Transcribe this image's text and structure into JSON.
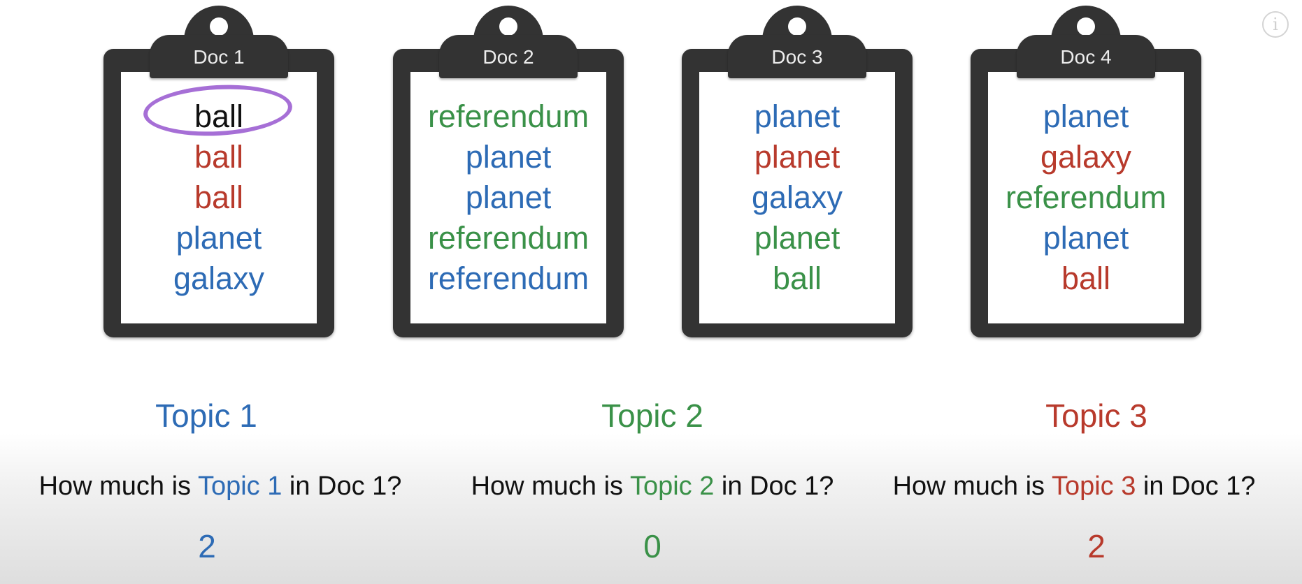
{
  "colors": {
    "topic1": "#2d6bb5",
    "topic2": "#3a9148",
    "topic3": "#b83a2c",
    "neutral": "#111111",
    "highlight": "#a66fd6"
  },
  "info_icon": "i",
  "documents": [
    {
      "label": "Doc 1",
      "words": [
        {
          "text": "ball",
          "topic": "neutral",
          "circled": true
        },
        {
          "text": "ball",
          "topic": "topic3"
        },
        {
          "text": "ball",
          "topic": "topic3"
        },
        {
          "text": "planet",
          "topic": "topic1"
        },
        {
          "text": "galaxy",
          "topic": "topic1"
        }
      ]
    },
    {
      "label": "Doc 2",
      "words": [
        {
          "text": "referendum",
          "topic": "topic2"
        },
        {
          "text": "planet",
          "topic": "topic1"
        },
        {
          "text": "planet",
          "topic": "topic1"
        },
        {
          "text": "referendum",
          "topic": "topic2"
        },
        {
          "text": "referendum",
          "topic": "topic1"
        }
      ]
    },
    {
      "label": "Doc 3",
      "words": [
        {
          "text": "planet",
          "topic": "topic1"
        },
        {
          "text": "planet",
          "topic": "topic3"
        },
        {
          "text": "galaxy",
          "topic": "topic1"
        },
        {
          "text": "planet",
          "topic": "topic2"
        },
        {
          "text": "ball",
          "topic": "topic2"
        }
      ]
    },
    {
      "label": "Doc 4",
      "words": [
        {
          "text": "planet",
          "topic": "topic1"
        },
        {
          "text": "galaxy",
          "topic": "topic3"
        },
        {
          "text": "referendum",
          "topic": "topic2"
        },
        {
          "text": "planet",
          "topic": "topic1"
        },
        {
          "text": "ball",
          "topic": "topic3"
        }
      ]
    }
  ],
  "topics": [
    {
      "title": "Topic 1",
      "color_key": "topic1",
      "question_prefix": "How much is ",
      "question_topic": "Topic 1",
      "question_suffix": " in Doc 1?",
      "count": "2"
    },
    {
      "title": "Topic 2",
      "color_key": "topic2",
      "question_prefix": "How much is ",
      "question_topic": "Topic 2",
      "question_suffix": " in Doc 1?",
      "count": "0"
    },
    {
      "title": "Topic 3",
      "color_key": "topic3",
      "question_prefix": "How much is ",
      "question_topic": "Topic 3",
      "question_suffix": " in Doc 1?",
      "count": "2"
    }
  ]
}
